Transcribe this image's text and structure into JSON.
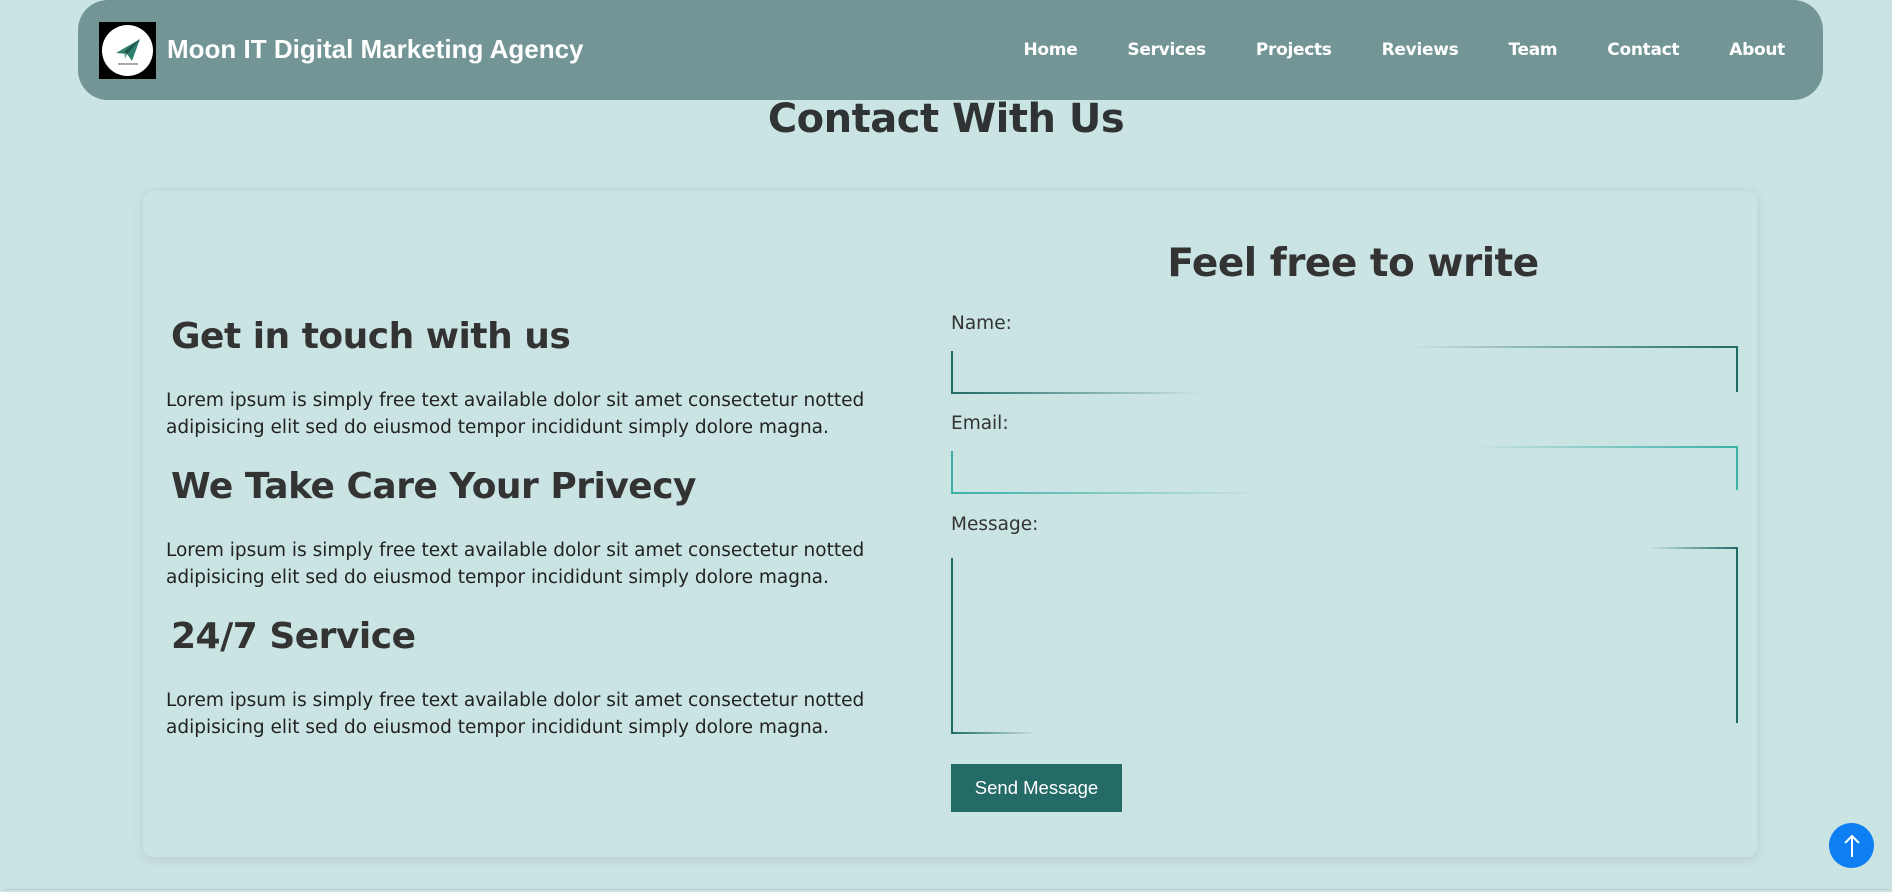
{
  "header": {
    "brand": "Moon IT Digital Marketing Agency",
    "logo_icon": "paper-plane-logo-icon",
    "nav": [
      {
        "label": "Home"
      },
      {
        "label": "Services"
      },
      {
        "label": "Projects"
      },
      {
        "label": "Reviews"
      },
      {
        "label": "Team"
      },
      {
        "label": "Contact"
      },
      {
        "label": "About"
      }
    ]
  },
  "page": {
    "title": "Contact With Us"
  },
  "info": {
    "sections": [
      {
        "heading": "Get in touch with us",
        "text": "Lorem ipsum is simply free text available dolor sit amet consectetur notted adipisicing elit sed do eiusmod tempor incididunt simply dolore magna."
      },
      {
        "heading": "We Take Care Your Privecy",
        "text": "Lorem ipsum is simply free text available dolor sit amet consectetur notted adipisicing elit sed do eiusmod tempor incididunt simply dolore magna."
      },
      {
        "heading": "24/7 Service",
        "text": "Lorem ipsum is simply free text available dolor sit amet consectetur notted adipisicing elit sed do eiusmod tempor incididunt simply dolore magna."
      }
    ]
  },
  "form": {
    "title": "Feel free to write",
    "name_label": "Name:",
    "name_value": "",
    "email_label": "Email:",
    "email_value": "",
    "message_label": "Message:",
    "message_value": "",
    "submit_label": "Send Message"
  },
  "scroll_top": {
    "icon": "arrow-up-icon"
  },
  "colors": {
    "background": "#cae3e3",
    "navbar": "#739595",
    "button": "#246b67",
    "scroll_button": "#0d7ff2",
    "field_border_dark": "#1f6b66",
    "field_border_teal": "#3bb0a6"
  }
}
